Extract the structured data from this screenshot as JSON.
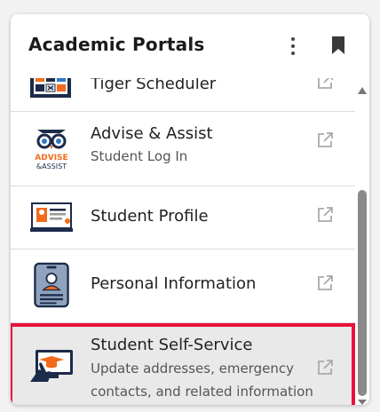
{
  "header": {
    "title": "Academic Portals"
  },
  "items": [
    {
      "label": "Tiger Scheduler",
      "sub": ""
    },
    {
      "label": "Advise & Assist",
      "sub": "Student Log In"
    },
    {
      "label": "Student Profile",
      "sub": ""
    },
    {
      "label": "Personal Information",
      "sub": ""
    },
    {
      "label": "Student Self-Service",
      "sub": "Update addresses, emergency contacts, and related information"
    }
  ],
  "icons": {
    "tiger": "calendar-scheduler-icon",
    "advise": "owl-advise-assist-logo",
    "profile": "profile-card-icon",
    "personal": "id-badge-icon",
    "selfservice": "hand-click-monitor-icon",
    "external": "external-link-icon"
  },
  "advise_logo_text": {
    "line1": "ADVISE",
    "line2": "&ASSIST"
  },
  "colors": {
    "highlight": "#e8123c",
    "accent_orange": "#f26b1d",
    "navy": "#1c2b4a"
  }
}
